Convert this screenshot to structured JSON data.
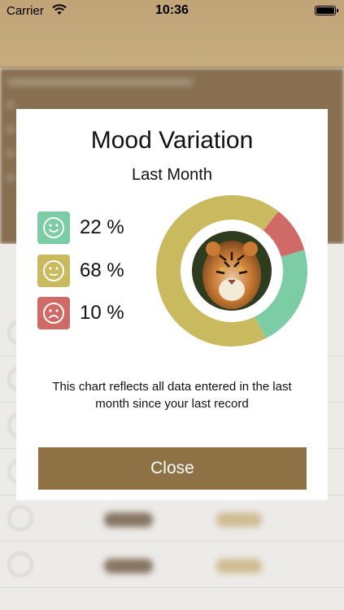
{
  "status_bar": {
    "carrier": "Carrier",
    "time": "10:36"
  },
  "modal": {
    "title": "Mood Variation",
    "subtitle": "Last Month",
    "moods": [
      {
        "icon": "happy-face-icon",
        "value": "22 %",
        "color": "#7ccca5"
      },
      {
        "icon": "neutral-face-icon",
        "value": "68 %",
        "color": "#c9b95f"
      },
      {
        "icon": "sad-face-icon",
        "value": "10 %",
        "color": "#d06a66"
      }
    ],
    "note": "This chart reflects all data entered in the last month since your last record",
    "close_label": "Close"
  },
  "chart_data": {
    "type": "pie",
    "categories": [
      "Happy",
      "Neutral",
      "Sad"
    ],
    "values": [
      22,
      68,
      10
    ],
    "colors": [
      "#7ccca5",
      "#c9b95f",
      "#d06a66"
    ]
  },
  "colors": {
    "accent": "#8f7146",
    "header": "#c9ab7c"
  }
}
